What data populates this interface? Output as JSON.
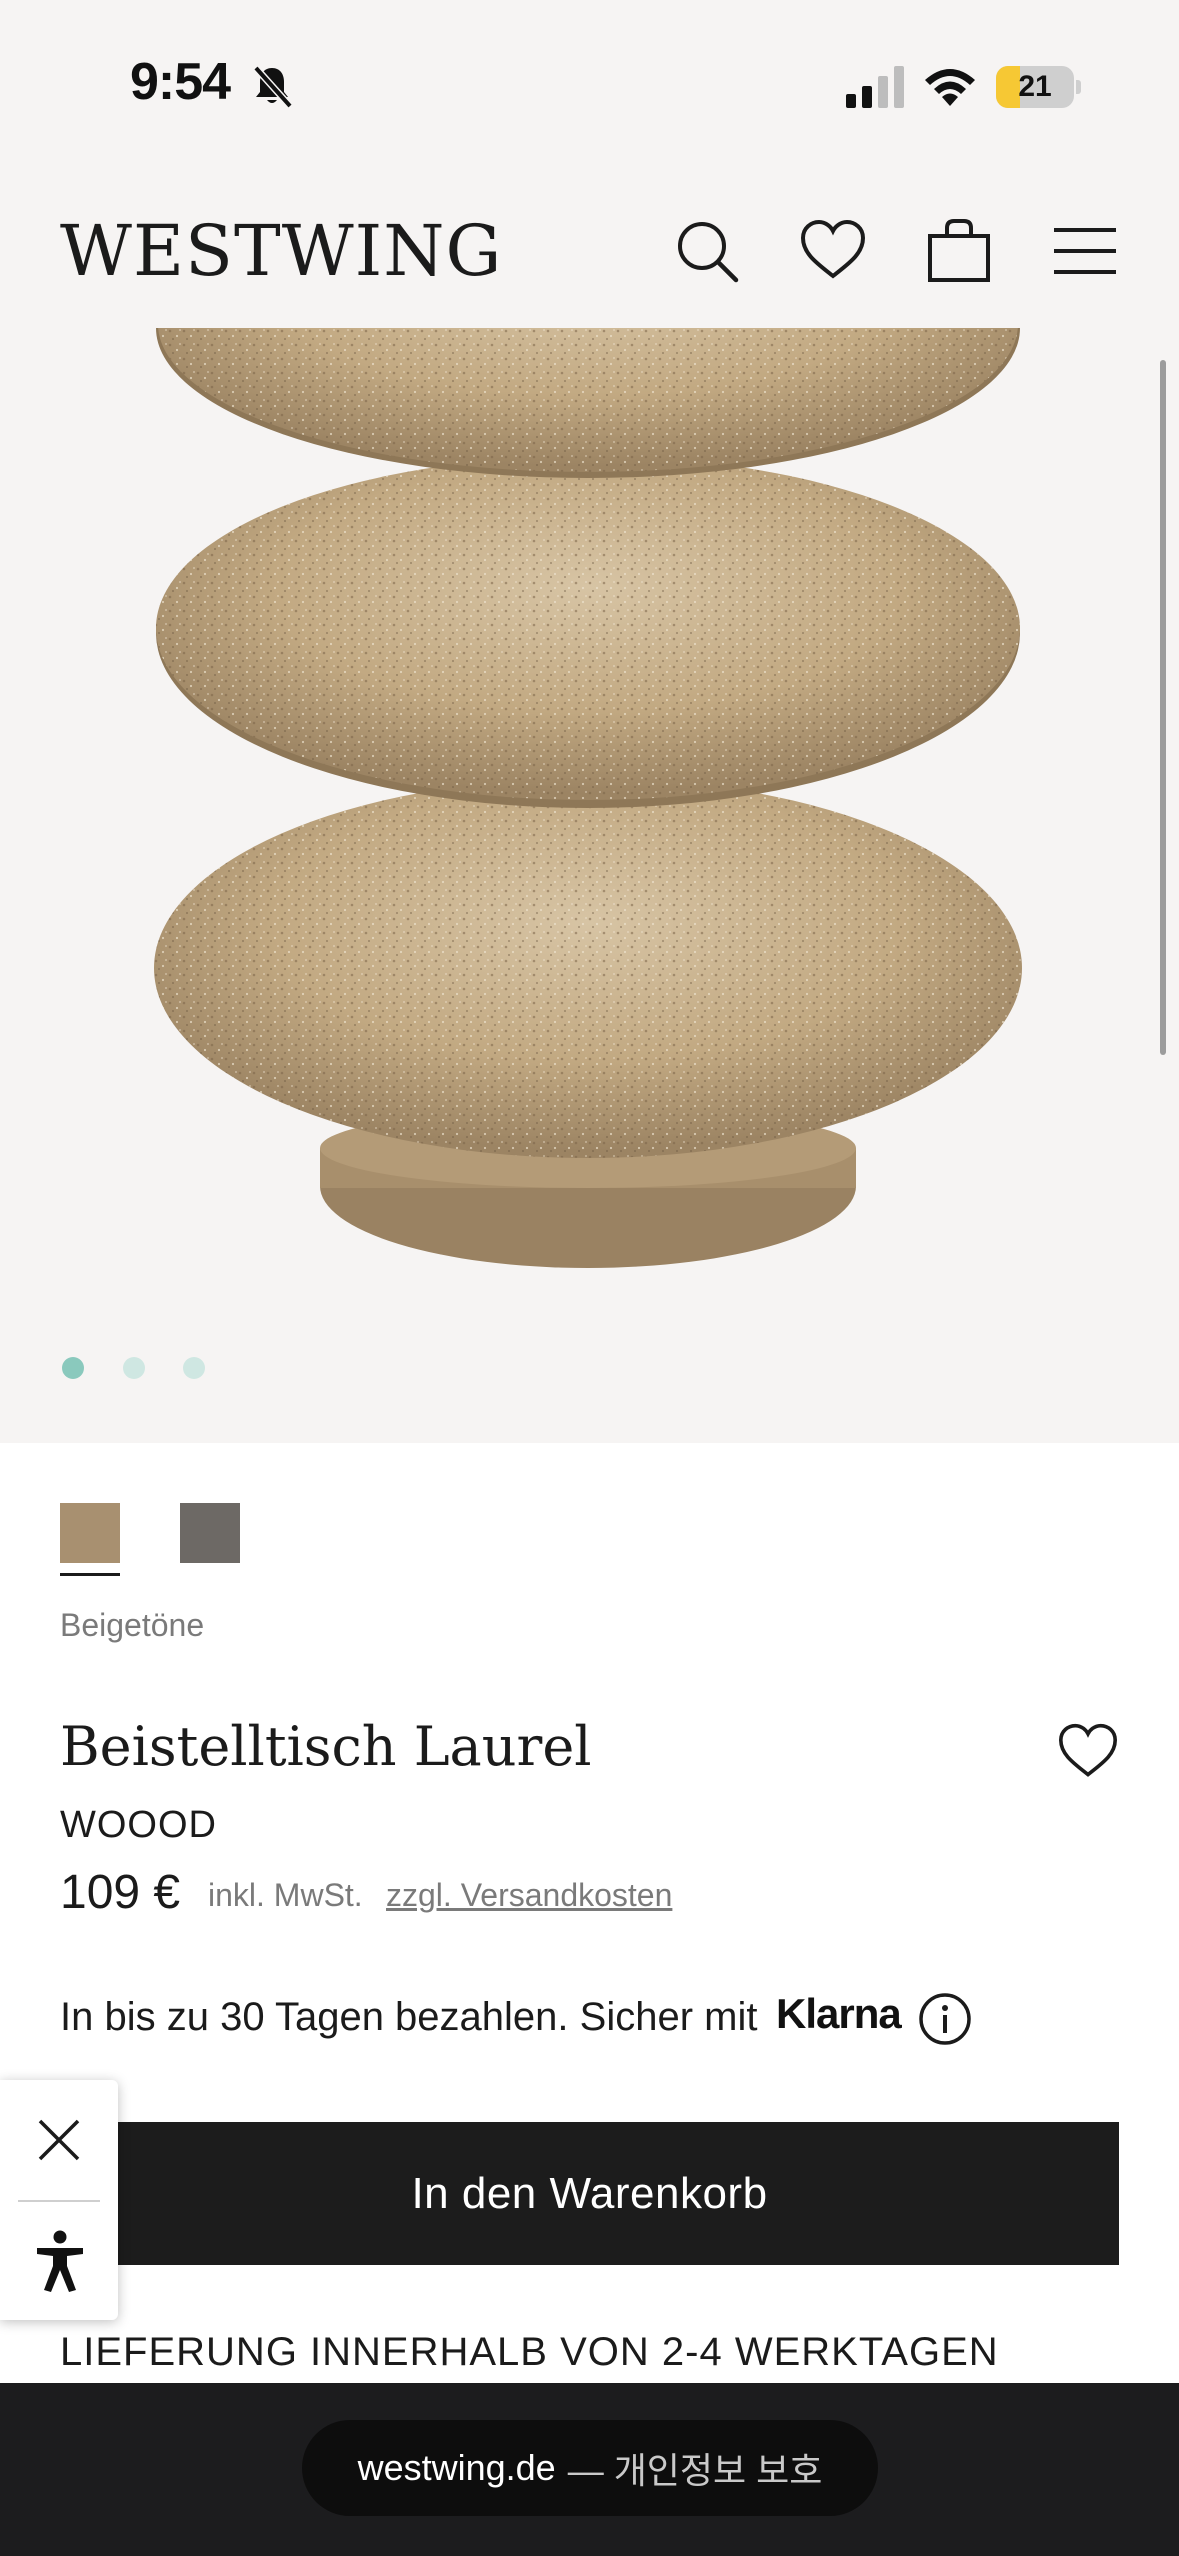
{
  "status_bar": {
    "time": "9:54",
    "battery_level": "21",
    "icons": [
      "bell-slash-icon",
      "signal-icon",
      "wifi-icon",
      "battery-icon"
    ]
  },
  "header": {
    "logo": "WESTWING",
    "icons": [
      "search-icon",
      "heart-icon",
      "bag-icon",
      "menu-icon"
    ]
  },
  "gallery": {
    "image_alt": "product-image",
    "dots": [
      {
        "active": true,
        "color": "#8ac9bd"
      },
      {
        "active": false,
        "color": "#cfe7e2"
      },
      {
        "active": false,
        "color": "#cfe7e2"
      }
    ]
  },
  "product": {
    "swatches": [
      {
        "name": "beige",
        "color": "#a89070",
        "selected": true
      },
      {
        "name": "grey",
        "color": "#6d6965",
        "selected": false
      }
    ],
    "color_name": "Beigetöne",
    "title": "Beistelltisch Laurel",
    "brand": "WOOOD",
    "price": "109 €",
    "tax_note": "inkl. MwSt.",
    "shipping_link": "zzgl. Versandkosten",
    "klarna_text": "In bis zu 30 Tagen bezahlen. Sicher mit",
    "klarna_logo": "Klarna",
    "add_to_cart": "In den Warenkorb",
    "delivery": "LIEFERUNG INNERHALB VON 2-4 WERKTAGEN"
  },
  "browser": {
    "url": "westwing.de",
    "url_suffix": "— 개인정보 보호"
  },
  "colors": {
    "background": "#f6f4f3",
    "button": "#1c1c1c",
    "accent_dot": "#8ac9bd"
  }
}
